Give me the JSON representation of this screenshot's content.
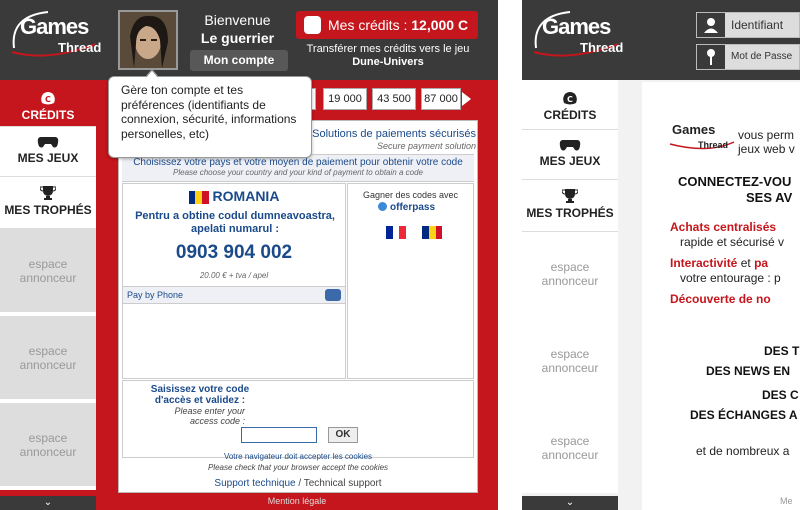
{
  "left": {
    "logo": {
      "games": "Games",
      "thread": "Thread"
    },
    "welcome": {
      "greeting": "Bienvenue",
      "name": "Le guerrier"
    },
    "account_button": "Mon compte",
    "credits": {
      "label": "Mes crédits :",
      "value": "12,000 C"
    },
    "transfer": {
      "line1": "Transférer mes crédits vers le jeu",
      "game": "Dune-Univers"
    },
    "sidebar": {
      "credits": "CRÉDITS",
      "games": "MES JEUX",
      "trophies": "MES TROPHÉS",
      "ads": [
        {
          "line1": "espace",
          "line2": "annonceur"
        },
        {
          "line1": "espace",
          "line2": "annonceur"
        },
        {
          "line1": "espace",
          "line2": "annonceur"
        }
      ]
    },
    "amounts": [
      "19 000",
      "43 500",
      "87 000"
    ],
    "tooltip": "Gère ton compte et tes préférences (identifiants de connexion, sécurité, informations personelles, etc)",
    "payment": {
      "title": "Solutions de paiements sécurisés",
      "subtitle": "Secure payment solution",
      "choose_fr": "Choisissez votre pays et votre moyen de paiement pour obtenir votre code",
      "choose_en": "Please choose your country and your kind of payment to obtain a code",
      "country": "ROMANIA",
      "obtain": "Pentru a obtine codul dumneavoastra, apelati numarul :",
      "phone": "0903 904 002",
      "price": "20.00 € + tva / apel",
      "pay_by_phone": "Pay by Phone",
      "earn_codes": "Gagner des codes avec",
      "offerpass": "offerpass",
      "code_label_fr": "Saisissez votre code d'accès et validez :",
      "code_label_en": "Please enter your access code :",
      "ok": "OK",
      "cookies_fr": "Votre navigateur doit accepter les cookies",
      "cookies_en": "Please check that your browser accept the cookies",
      "support_fr": "Support technique",
      "support_sep": "/",
      "support_en": "Technical support"
    },
    "mention": "Mention légale"
  },
  "right": {
    "logo": {
      "games": "Games",
      "thread": "Thread"
    },
    "ident_placeholder": "Identifiant",
    "pass_placeholder": "Mot de Passe",
    "sidebar": {
      "credits": "CRÉDITS",
      "games": "MES JEUX",
      "trophies": "MES TROPHÉS",
      "ads": [
        {
          "line1": "espace",
          "line2": "annonceur"
        },
        {
          "line1": "espace",
          "line2": "annonceur"
        },
        {
          "line1": "espace",
          "line2": "annonceur"
        }
      ]
    },
    "perm_line1": "vous perm",
    "perm_line2": "jeux web v",
    "headline1": "CONNECTEZ-VOU",
    "headline2": "SES AV",
    "bullet1_red": "Achats centralisés",
    "bullet1_rest": "rapide et sécurisé v",
    "bullet2_red1": "Interactivité",
    "bullet2_mid": "et",
    "bullet2_red2": "pa",
    "bullet2_rest": "votre entourage : p",
    "bullet3_red": "Découverte de no",
    "caps1": "DES T",
    "caps2": "DES NEWS EN",
    "caps3": "DES C",
    "caps4": "DES ÉCHANGES A",
    "more": "et de nombreux a",
    "mention": "Me"
  },
  "colors": {
    "brand_red": "#c4161c",
    "dark": "#3a3a3a",
    "link_blue": "#1a4a8a"
  },
  "icons": [
    "coin-icon",
    "gamepad-icon",
    "trophy-icon",
    "chevron-down-icon",
    "phone-icon",
    "user-icon",
    "key-icon",
    "chevron-right-icon"
  ]
}
